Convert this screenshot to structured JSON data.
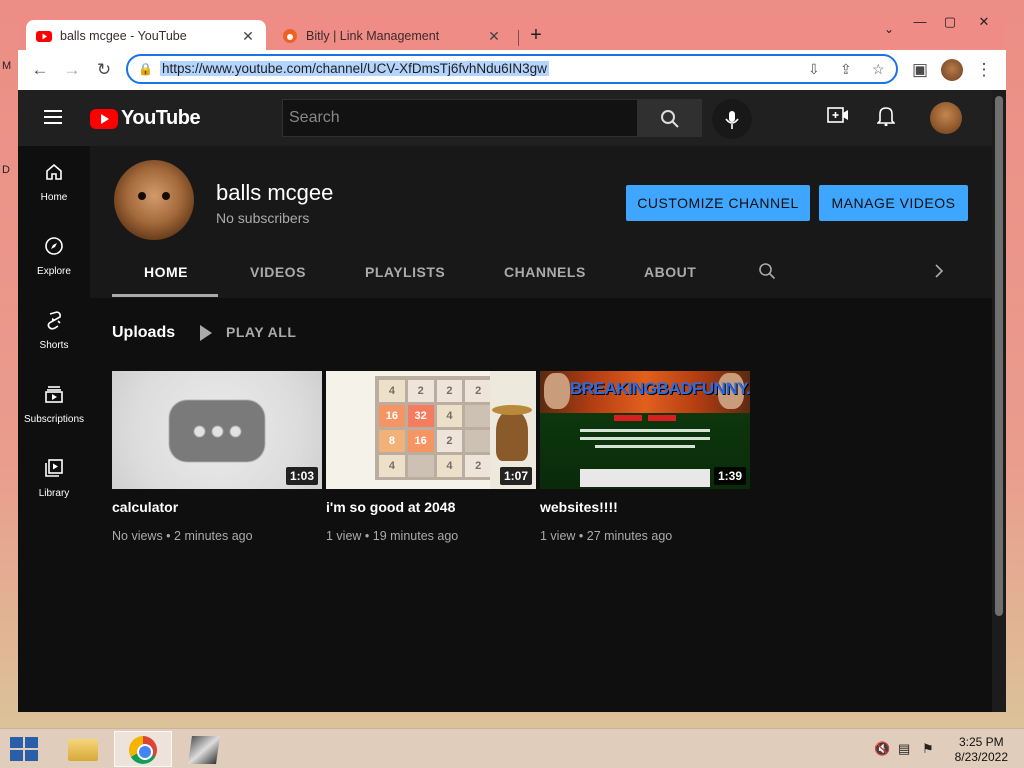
{
  "browser": {
    "tabs": [
      {
        "title": "balls mcgee - YouTube",
        "active": true,
        "icon": "youtube-icon"
      },
      {
        "title": "Bitly | Link Management",
        "active": false,
        "icon": "bitly-icon"
      }
    ],
    "new_tab": "+",
    "url": "https://www.youtube.com/channel/UCV-XfDmsTj6fvhNdu6IN3gw"
  },
  "youtube": {
    "logo_text": "YouTube",
    "search_placeholder": "Search",
    "sidebar": [
      {
        "label": "Home",
        "icon": "home-icon"
      },
      {
        "label": "Explore",
        "icon": "compass-icon"
      },
      {
        "label": "Shorts",
        "icon": "shorts-icon"
      },
      {
        "label": "Subscriptions",
        "icon": "subscriptions-icon"
      },
      {
        "label": "Library",
        "icon": "library-icon"
      }
    ],
    "channel": {
      "name": "balls mcgee",
      "subscribers": "No subscribers",
      "customize_label": "CUSTOMIZE CHANNEL",
      "manage_label": "MANAGE VIDEOS",
      "tabs": [
        "HOME",
        "VIDEOS",
        "PLAYLISTS",
        "CHANNELS",
        "ABOUT"
      ],
      "active_tab": "HOME"
    },
    "uploads": {
      "title": "Uploads",
      "play_all": "PLAY ALL",
      "videos": [
        {
          "title": "calculator",
          "duration": "1:03",
          "meta": "No views • 2 minutes ago"
        },
        {
          "title": "i'm so good at 2048",
          "duration": "1:07",
          "meta": "1 view • 19 minutes ago"
        },
        {
          "title": "websites!!!!",
          "duration": "1:39",
          "meta": "1 view • 27 minutes ago"
        }
      ],
      "thumb2_tiles": [
        "4",
        "2",
        "2",
        "2",
        "16",
        "32",
        "4",
        "",
        "8",
        "16",
        "2",
        "",
        "4",
        "",
        "4",
        "2"
      ],
      "thumb3_banner": "BREAKINGBADFUNNY.COM"
    },
    "colors": {
      "background": "#0f0f0f",
      "header": "#202020",
      "accent_blue": "#3ea6ff",
      "brand_red": "#ff0000"
    }
  },
  "taskbar": {
    "time": "3:25 PM",
    "date": "8/23/2022"
  }
}
